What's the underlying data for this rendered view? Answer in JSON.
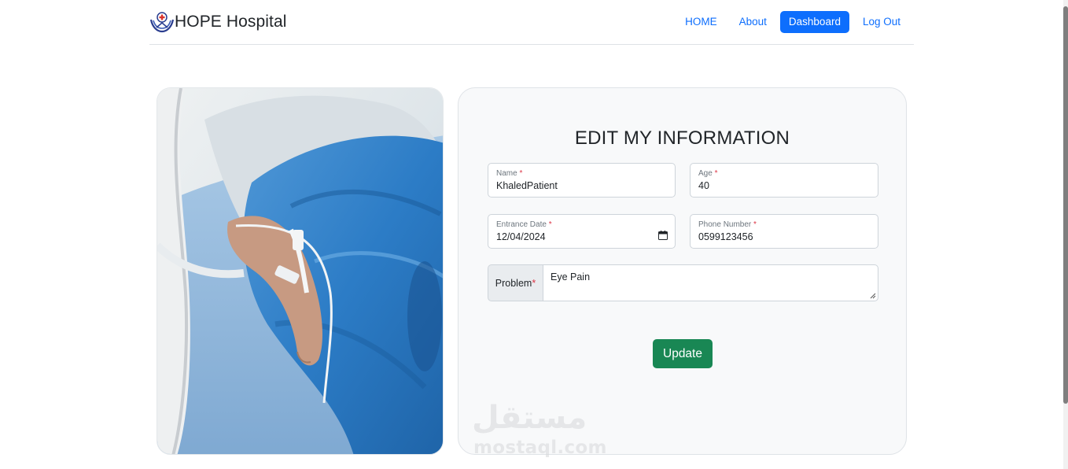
{
  "navbar": {
    "brand_name": "HOPE Hospital",
    "logo_icon": "hospital-hands-logo-icon",
    "links": [
      {
        "label": "HOME",
        "active": false
      },
      {
        "label": "About",
        "active": false
      },
      {
        "label": "Dashboard",
        "active": true
      },
      {
        "label": "Log Out",
        "active": false
      }
    ]
  },
  "form": {
    "title": "EDIT MY INFORMATION",
    "name": {
      "label": "Name",
      "required": "*",
      "value": "KhaledPatient"
    },
    "age": {
      "label": "Age",
      "required": "*",
      "value": "40"
    },
    "entrance_date": {
      "label": "Entrance Date",
      "required": "*",
      "value": "12/04/2024"
    },
    "phone": {
      "label": "Phone Number",
      "required": "*",
      "value": "0599123456"
    },
    "problem": {
      "label": "Problem",
      "required": "*",
      "value": "Eye Pain"
    },
    "update_label": "Update"
  },
  "watermark": {
    "arabic": "مستقل",
    "latin": "mostaql.com"
  },
  "colors": {
    "primary": "#0d6efd",
    "success": "#198754",
    "danger": "#dc3545",
    "card_bg": "#f8f9fa"
  }
}
